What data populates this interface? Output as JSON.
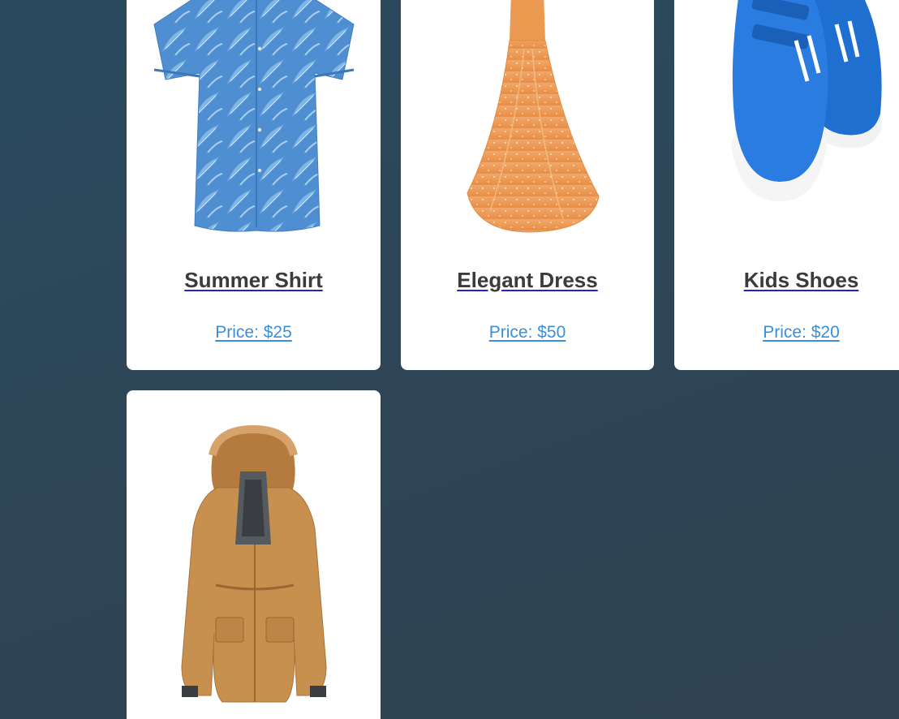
{
  "products": [
    {
      "name": "Summer Shirt",
      "price": "Price: $25",
      "image": "shirt-image"
    },
    {
      "name": "Elegant Dress",
      "price": "Price: $50",
      "image": "dress-image"
    },
    {
      "name": "Kids Shoes",
      "price": "Price: $20",
      "image": "shoes-image"
    },
    {
      "name": "",
      "price": "",
      "image": "jacket-image"
    }
  ],
  "colors": {
    "background": "#2e4556",
    "card": "#ffffff",
    "title": "#3b3b3b",
    "price": "#3a8fd6"
  }
}
